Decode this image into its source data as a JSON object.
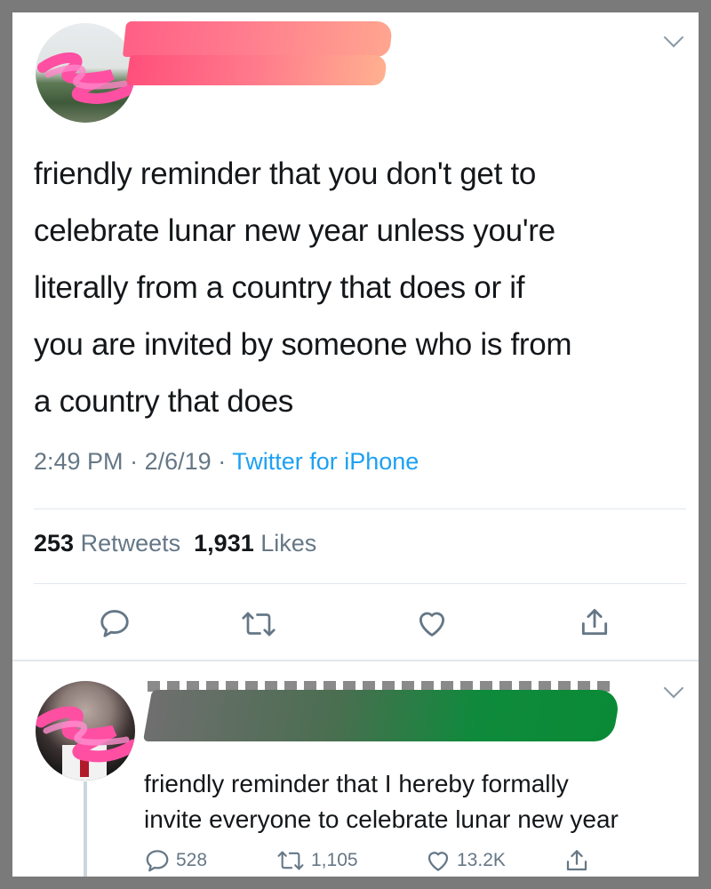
{
  "tweet": {
    "text_lines": [
      "friendly reminder that you don't get to",
      "celebrate lunar new year unless you're",
      "literally from a country that does or if",
      "you are invited by someone who is from",
      "a country that does"
    ],
    "time": "2:49 PM",
    "date": "2/6/19",
    "source": "Twitter for iPhone",
    "separator": "·",
    "retweets_count": "253",
    "retweets_label": "Retweets",
    "likes_count": "1,931",
    "likes_label": "Likes"
  },
  "reply": {
    "text_lines": [
      "friendly reminder that I hereby formally",
      "invite everyone to celebrate lunar new year"
    ],
    "reply_count": "528",
    "retweet_count": "1,105",
    "like_count": "13.2K"
  },
  "icons": {
    "chevron": "chevron-down-icon",
    "reply": "reply-icon",
    "retweet": "retweet-icon",
    "like": "heart-icon",
    "share": "share-icon"
  },
  "colors": {
    "text": "#14171a",
    "secondary": "#657786",
    "link": "#1da1f2",
    "icon": "#657786",
    "divider": "#e1e8ed"
  }
}
